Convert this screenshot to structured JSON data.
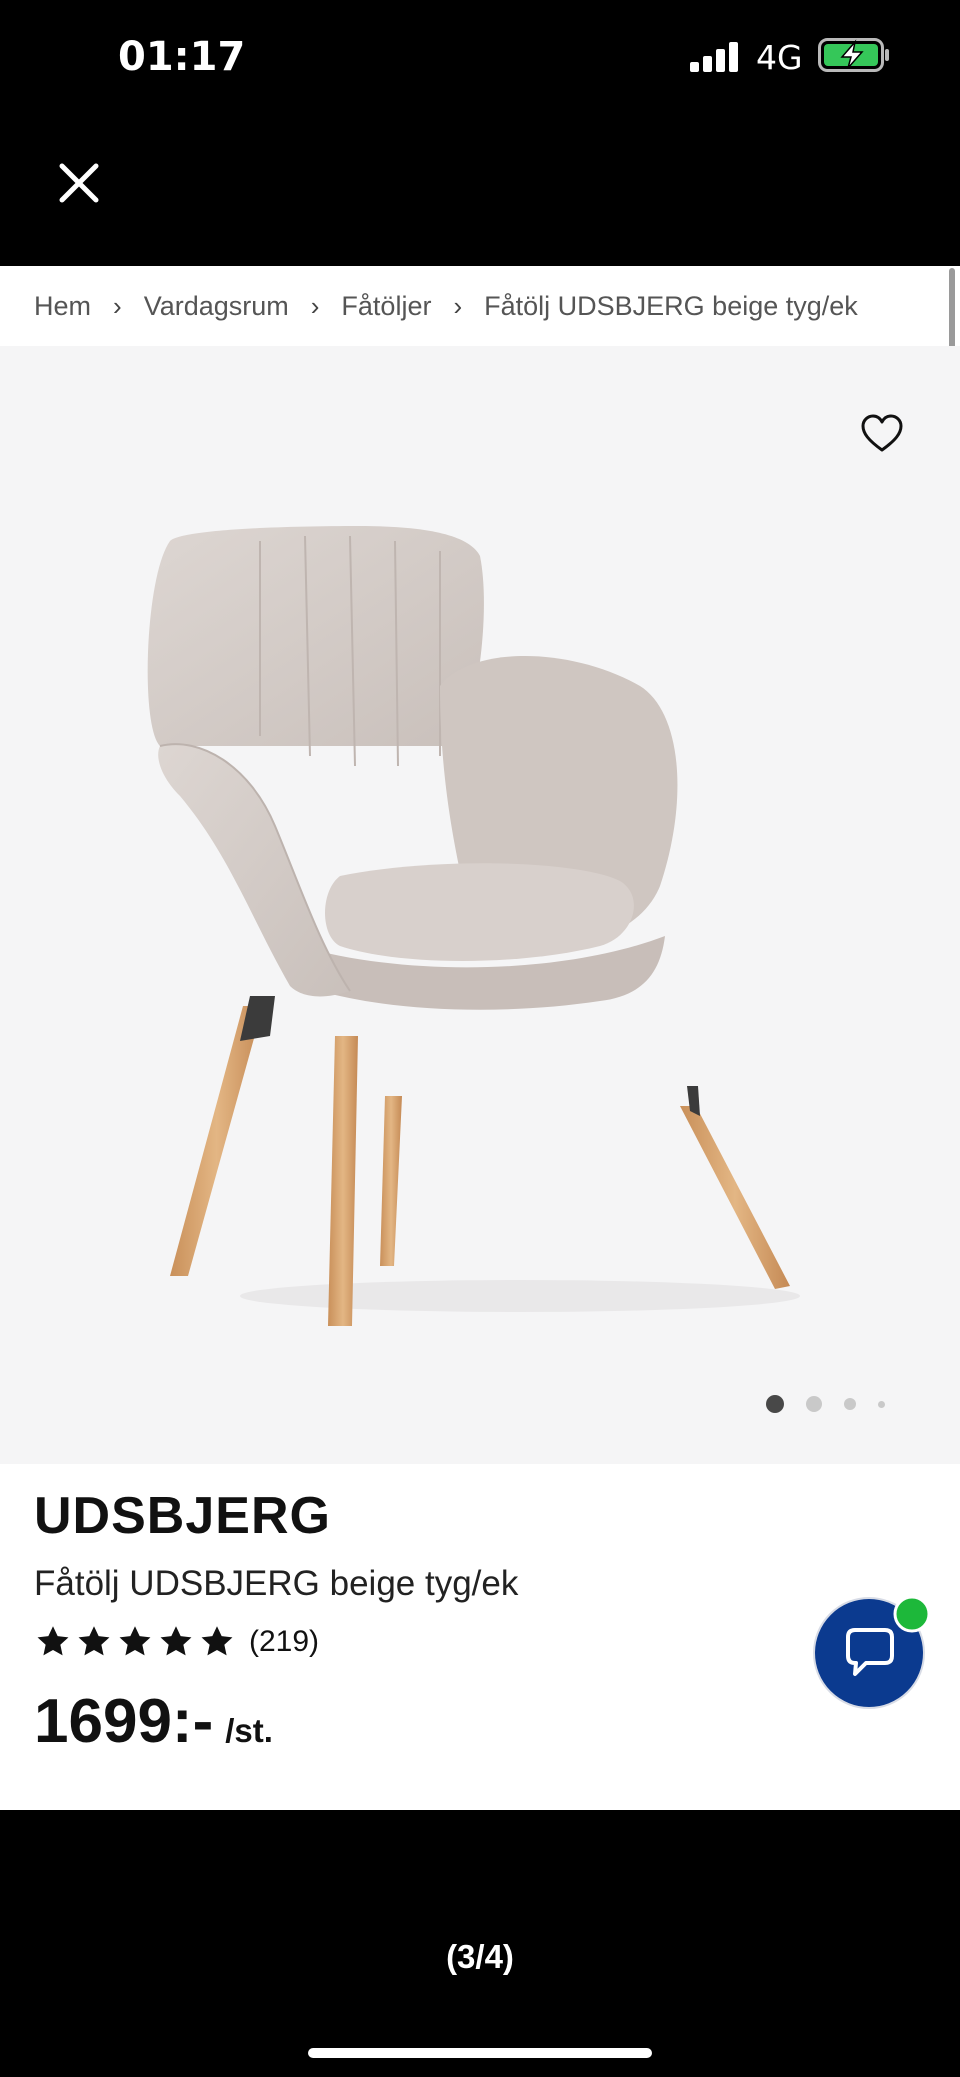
{
  "status_bar": {
    "time": "01:17",
    "network": "4G",
    "battery_icon": "battery-charging-icon",
    "signal_icon": "cellular-signal-icon"
  },
  "toolbar": {
    "close_icon": "close-icon"
  },
  "breadcrumb": {
    "items": [
      "Hem",
      "Vardagsrum",
      "Fåtöljer",
      "Fåtölj UDSBJERG beige tyg/ek"
    ],
    "separator_icon": "chevron-right-icon"
  },
  "gallery": {
    "image_subject": "beige upholstered armchair with oak legs",
    "favorite_icon": "heart-outline-icon",
    "pager_count": 4,
    "pager_active_index": 0
  },
  "product": {
    "brand": "UDSBJERG",
    "name": "Fåtölj UDSBJERG beige tyg/ek",
    "rating_stars": 5,
    "review_count": "(219)",
    "price": "1699:-",
    "price_unit": "/st."
  },
  "chat": {
    "icon": "chat-bubble-icon",
    "status_color": "#1db83a",
    "button_color": "#0b3a8f"
  },
  "viewer": {
    "page_counter": "(3/4)"
  }
}
